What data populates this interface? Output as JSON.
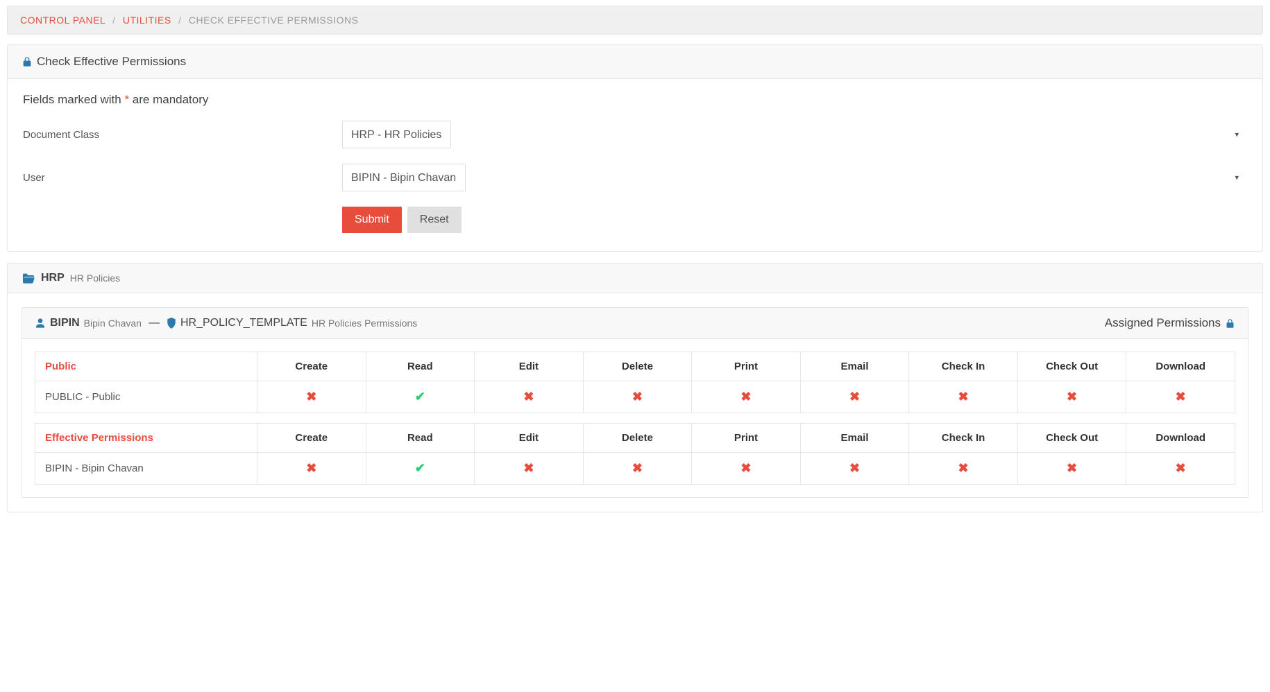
{
  "breadcrumb": {
    "items": [
      "CONTROL PANEL",
      "UTILITIES",
      "CHECK EFFECTIVE PERMISSIONS"
    ]
  },
  "form_panel": {
    "title": "Check Effective Permissions",
    "note_pre": "Fields marked with ",
    "note_post": " are mandatory",
    "fields": {
      "doc_class_label": "Document Class",
      "doc_class_value": "HRP - HR Policies",
      "user_label": "User",
      "user_value": "BIPIN - Bipin Chavan"
    },
    "buttons": {
      "submit": "Submit",
      "reset": "Reset"
    }
  },
  "result": {
    "class_code": "HRP",
    "class_desc": "HR Policies",
    "user_code": "BIPIN",
    "user_desc": "Bipin Chavan",
    "template_code": "HR_POLICY_TEMPLATE",
    "template_desc": "HR Policies Permissions",
    "assigned_label": "Assigned Permissions",
    "columns": [
      "Create",
      "Read",
      "Edit",
      "Delete",
      "Print",
      "Email",
      "Check In",
      "Check Out",
      "Download"
    ],
    "tables": [
      {
        "label": "Public",
        "rows": [
          {
            "name": "PUBLIC - Public",
            "perm": [
              false,
              true,
              false,
              false,
              false,
              false,
              false,
              false,
              false
            ]
          }
        ]
      },
      {
        "label": "Effective Permissions",
        "rows": [
          {
            "name": "BIPIN - Bipin Chavan",
            "perm": [
              false,
              true,
              false,
              false,
              false,
              false,
              false,
              false,
              false
            ]
          }
        ]
      }
    ]
  }
}
